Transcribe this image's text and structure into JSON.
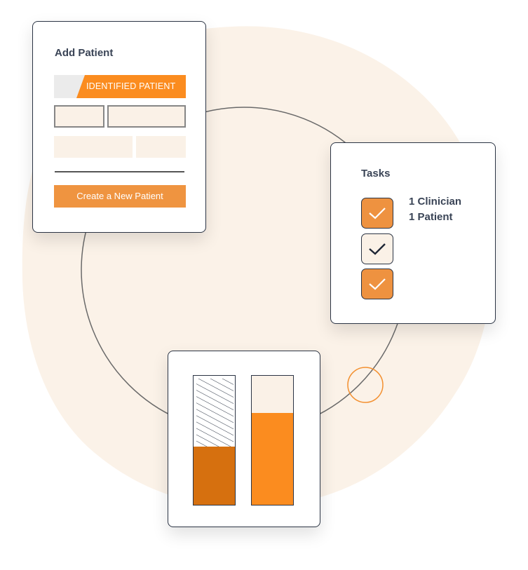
{
  "add_patient_card": {
    "title": "Add Patient",
    "segment_label": "IDENTIFIED PATIENT",
    "create_button_label": "Create a New Patient"
  },
  "tasks_card": {
    "title": "Tasks",
    "checkboxes": [
      {
        "checked": true,
        "style": "orange"
      },
      {
        "checked": true,
        "style": "light"
      },
      {
        "checked": true,
        "style": "orange"
      }
    ],
    "lines": [
      "1 Clinician",
      "1 Patient"
    ]
  },
  "bars_card": {
    "bars": [
      {
        "name": "bar-left",
        "fill_fraction": 0.45,
        "fill_color": "#d6700f",
        "empty_pattern": "hatched"
      },
      {
        "name": "bar-right",
        "fill_fraction": 0.71,
        "fill_color": "#fb8c1f",
        "empty_pattern": "cream"
      }
    ]
  },
  "colors": {
    "accent_orange": "#fb8c1f",
    "button_orange": "#ef9440",
    "dark_orange": "#d6700f",
    "cream": "#faf1e7",
    "ink": "#2b3444",
    "text": "#3a4456"
  }
}
